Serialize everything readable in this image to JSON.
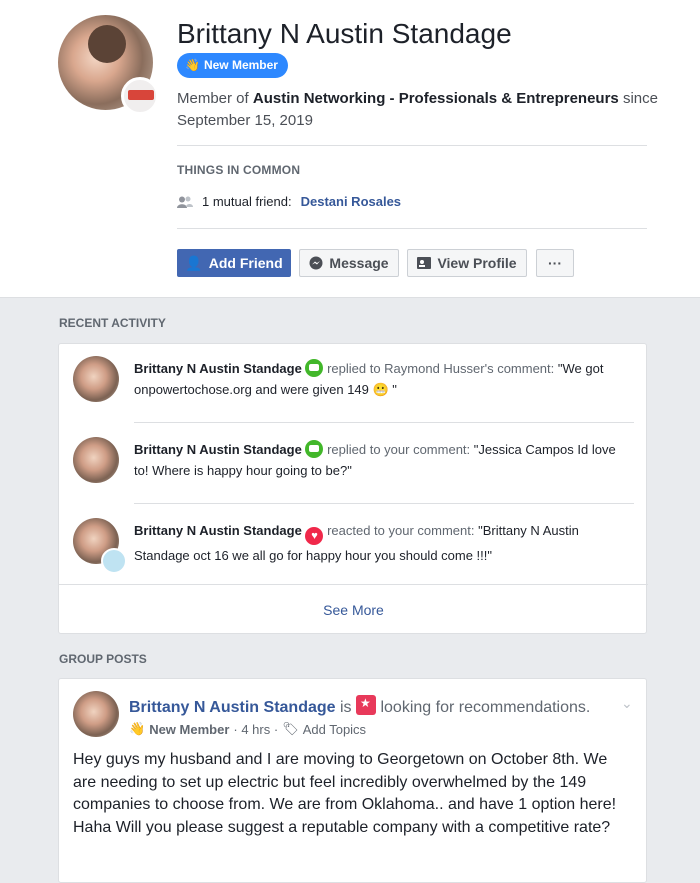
{
  "profile": {
    "name": "Brittany N Austin Standage",
    "badge": "New Member",
    "member_prefix": "Member of",
    "group_name": "Austin Networking - Professionals & Entrepreneurs",
    "member_since_word": "since",
    "member_since_date": "September 15, 2019",
    "things_heading": "THINGS IN COMMON",
    "mutual_prefix": "1 mutual friend:",
    "mutual_friend": "Destani Rosales",
    "buttons": {
      "add_friend": "Add Friend",
      "message": "Message",
      "view_profile": "View Profile",
      "more": "···"
    }
  },
  "recent_activity": {
    "heading": "RECENT ACTIVITY",
    "items": [
      {
        "actor": "Brittany N Austin Standage",
        "verb": "replied to Raymond Husser's comment:",
        "text": "\"We got onpowertochose.org and were given 149 😬 \""
      },
      {
        "actor": "Brittany N Austin Standage",
        "verb": "replied to your comment:",
        "text": "\"Jessica Campos Id love to! Where is happy hour going to be?\""
      },
      {
        "actor": "Brittany N Austin Standage",
        "verb": "reacted to your comment:",
        "text": "\"Brittany N Austin Standage oct 16 we all go for happy hour you should come !!!\""
      }
    ],
    "see_more": "See More"
  },
  "group_posts": {
    "heading": "GROUP POSTS",
    "post": {
      "author": "Brittany N Austin Standage",
      "is": "is",
      "status": "looking for recommendations.",
      "member_label": "New Member",
      "time": "· 4 hrs ·",
      "add_topics": "Add Topics",
      "body": "Hey guys my husband and I are moving to Georgetown on October 8th. We are needing to set up electric but feel incredibly overwhelmed by the 149 companies to choose from. We are from Oklahoma.. and have 1 option here! Haha Will you please suggest a reputable company with a competitive rate?"
    }
  },
  "colors": {
    "accent": "#4267b2",
    "link": "#365899",
    "badge": "#2d88ff",
    "reply_green": "#42b72a",
    "heart_red": "#f0284a"
  }
}
